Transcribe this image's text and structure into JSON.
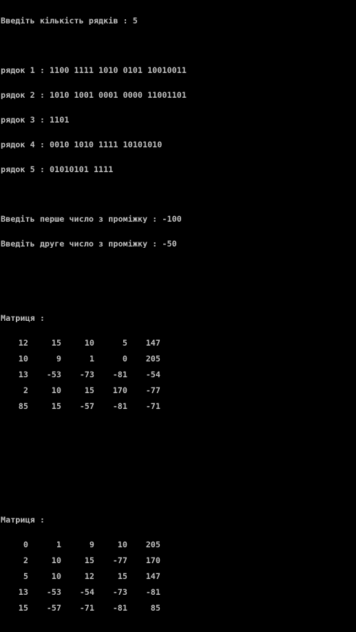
{
  "console": {
    "prompt_count": "Введіть кількість рядків : 5",
    "rows": [
      "рядок 1 : 1100 1111 1010 0101 10010011",
      "рядок 2 : 1010 1001 0001 0000 11001101",
      "рядок 3 : 1101",
      "рядок 4 : 0010 1010 1111 10101010",
      "рядок 5 : 01010101 1111"
    ],
    "prompt_first": "Введіть перше число з проміжку : -100",
    "prompt_second": "Введіть друге число з проміжку : -50",
    "matrix1": {
      "title": "Матриця :",
      "rows": [
        [
          "12",
          "15",
          "10",
          "5",
          "147"
        ],
        [
          "10",
          "9",
          "1",
          "0",
          "205"
        ],
        [
          "13",
          "-53",
          "-73",
          "-81",
          "-54"
        ],
        [
          "2",
          "10",
          "15",
          "170",
          "-77"
        ],
        [
          "85",
          "15",
          "-57",
          "-81",
          "-71"
        ]
      ]
    },
    "matrix2": {
      "title": "Матриця :",
      "rows": [
        [
          "0",
          "1",
          "9",
          "10",
          "205"
        ],
        [
          "2",
          "10",
          "15",
          "-77",
          "170"
        ],
        [
          "5",
          "10",
          "12",
          "15",
          "147"
        ],
        [
          "13",
          "-53",
          "-54",
          "-73",
          "-81"
        ],
        [
          "15",
          "-57",
          "-71",
          "-81",
          "85"
        ]
      ]
    }
  },
  "colors": {
    "background": "#000000",
    "text": "#c0c0c0"
  }
}
